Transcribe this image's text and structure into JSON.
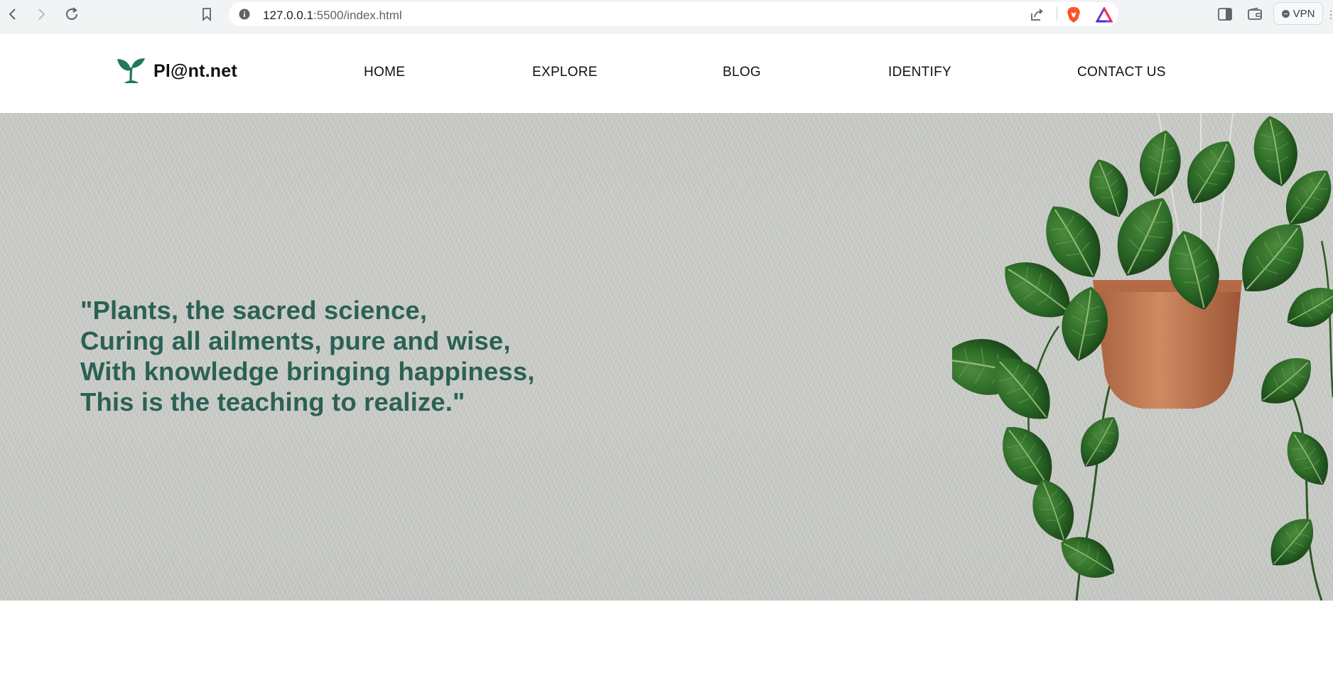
{
  "browser": {
    "url_host": "127.0.0.1",
    "url_path": ":5500/index.html",
    "vpn_label": "VPN",
    "icons": [
      "back-icon",
      "forward-icon",
      "reload-icon",
      "bookmark-icon",
      "info-icon",
      "share-icon",
      "brave-shield-icon",
      "brave-rewards-icon",
      "sidebar-icon",
      "wallet-icon",
      "menu-icon"
    ]
  },
  "site": {
    "logo_text": "Pl@nt.net",
    "logo_icon": "sprout-icon",
    "nav": [
      "HOME",
      "EXPLORE",
      "BLOG",
      "IDENTIFY",
      "CONTACT US"
    ]
  },
  "hero": {
    "quote_lines": [
      "\"Plants, the sacred science,",
      "Curing all ailments, pure and wise,",
      "With knowledge bringing happiness,",
      "This is the teaching to realize.\""
    ],
    "image": "hanging-pothos-plant"
  },
  "colors": {
    "quote": "#2b6155",
    "logo_green": "#1f7a5a",
    "hero_bg": "#cacbc8",
    "leaf_dark": "#1f4a1d",
    "leaf_mid": "#2f6a2a",
    "pot": "#c07a56"
  }
}
